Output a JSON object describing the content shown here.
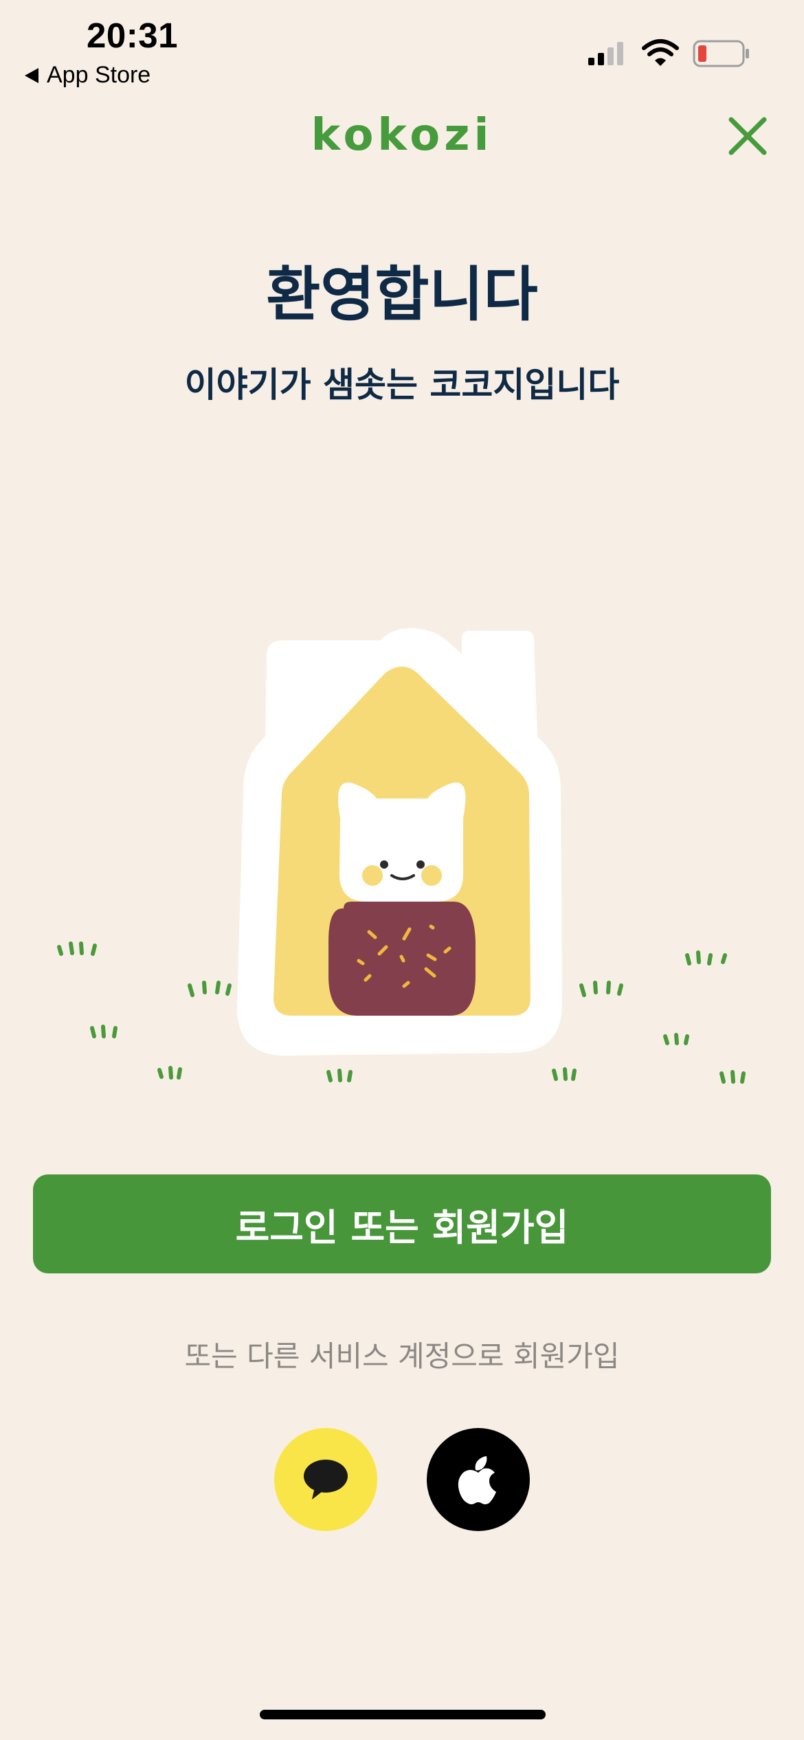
{
  "status_bar": {
    "time": "20:31",
    "back_label": "App Store",
    "battery_color": "#E5453A"
  },
  "header": {
    "brand": "kokozi",
    "close_icon": "close-icon"
  },
  "welcome": {
    "title": "환영합니다",
    "subtitle": "이야기가 샘솟는 코코지입니다"
  },
  "actions": {
    "login_button": "로그인 또는 회원가입",
    "alt_signup_text": "또는 다른 서비스 계정으로 회원가입",
    "social_buttons": [
      {
        "icon": "kakao-speech-bubble-icon",
        "color": "#F9E547"
      },
      {
        "icon": "apple-logo-icon",
        "color": "#000000"
      }
    ]
  },
  "colors": {
    "brand_green": "#47963A",
    "background": "#F7EFE5",
    "text_navy": "#0F2A46"
  }
}
